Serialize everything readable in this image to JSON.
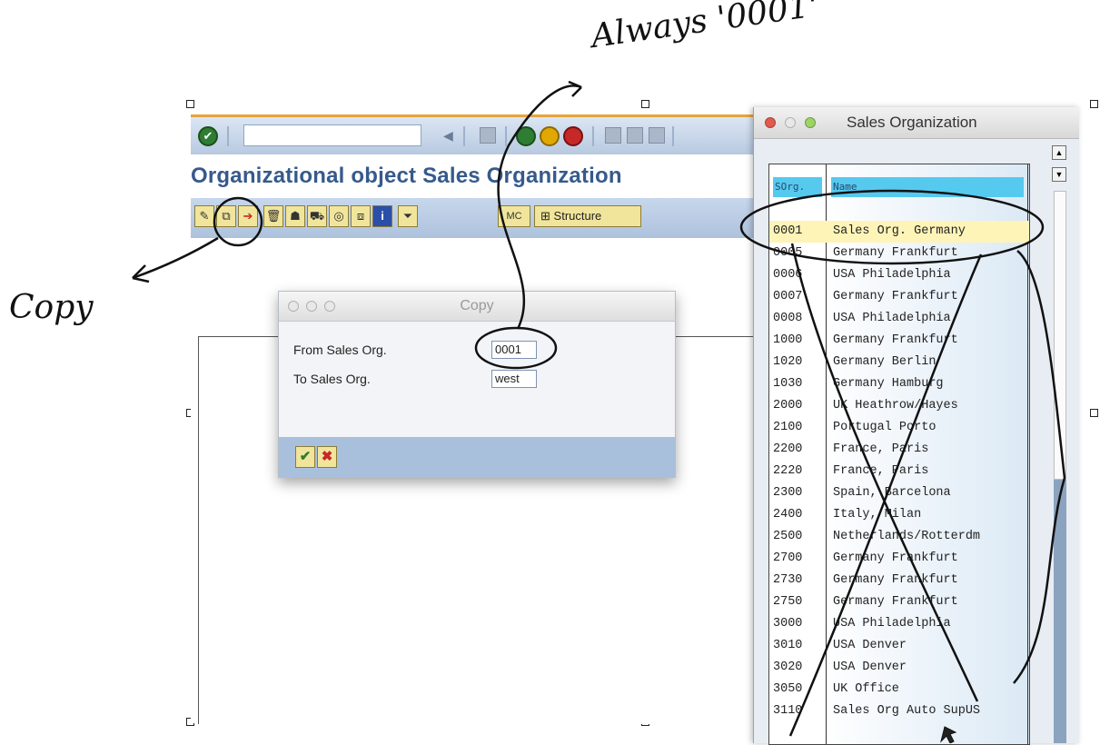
{
  "main": {
    "title": "Organizational object Sales Organization",
    "toolbar": {
      "command_value": "",
      "icons": [
        "check-icon",
        "back-icon",
        "save-icon",
        "back-green-icon",
        "exit-icon",
        "cancel-icon",
        "print-icon",
        "find-icon",
        "find-next-icon"
      ]
    },
    "app_toolbar": {
      "icons": [
        "edit-icon",
        "copy-icon",
        "copy-with-ref-icon",
        "delete-icon",
        "overview-icon",
        "transport-icon",
        "navigate-icon",
        "details-icon",
        "info-icon",
        "filter-icon"
      ],
      "mc_label": "MC",
      "structure_label": "Structure"
    }
  },
  "copy_dialog": {
    "title": "Copy",
    "from_label": "From Sales Org.",
    "from_value": "0001",
    "to_label": "To Sales Org.",
    "to_value": "west",
    "ok_icon": "✔",
    "cancel_icon": "✖"
  },
  "sales_org_popup": {
    "title": "Sales Organization",
    "col_code": "SOrg.",
    "col_name": "Name",
    "rows": [
      {
        "code": "0001",
        "name": "Sales Org. Germany",
        "selected": true
      },
      {
        "code": "0005",
        "name": "Germany Frankfurt"
      },
      {
        "code": "0006",
        "name": "USA Philadelphia"
      },
      {
        "code": "0007",
        "name": "Germany Frankfurt"
      },
      {
        "code": "0008",
        "name": "USA Philadelphia"
      },
      {
        "code": "1000",
        "name": "Germany Frankfurt"
      },
      {
        "code": "1020",
        "name": "Germany Berlin"
      },
      {
        "code": "1030",
        "name": "Germany Hamburg"
      },
      {
        "code": "2000",
        "name": "UK Heathrow/Hayes"
      },
      {
        "code": "2100",
        "name": "Portugal Porto"
      },
      {
        "code": "2200",
        "name": "France, Paris"
      },
      {
        "code": "2220",
        "name": "France, Paris"
      },
      {
        "code": "2300",
        "name": "Spain, Barcelona"
      },
      {
        "code": "2400",
        "name": "Italy, Milan"
      },
      {
        "code": "2500",
        "name": "Netherlands/Rotterdm"
      },
      {
        "code": "2700",
        "name": "Germany Frankfurt"
      },
      {
        "code": "2730",
        "name": "Germany Frankfurt"
      },
      {
        "code": "2750",
        "name": "Germany Frankfurt"
      },
      {
        "code": "3000",
        "name": "USA Philadelphia"
      },
      {
        "code": "3010",
        "name": "USA Denver"
      },
      {
        "code": "3020",
        "name": "USA Denver"
      },
      {
        "code": "3050",
        "name": "UK Office"
      },
      {
        "code": "3110",
        "name": "Sales Org Auto SupUS"
      }
    ]
  },
  "annotations": {
    "copy": "Copy",
    "always": "Always '0001'"
  },
  "colors": {
    "title_blue": "#365a8c",
    "button_yellow": "#f1e59b",
    "header_cyan": "#56c9ef",
    "selected_row": "#fff4b8"
  }
}
